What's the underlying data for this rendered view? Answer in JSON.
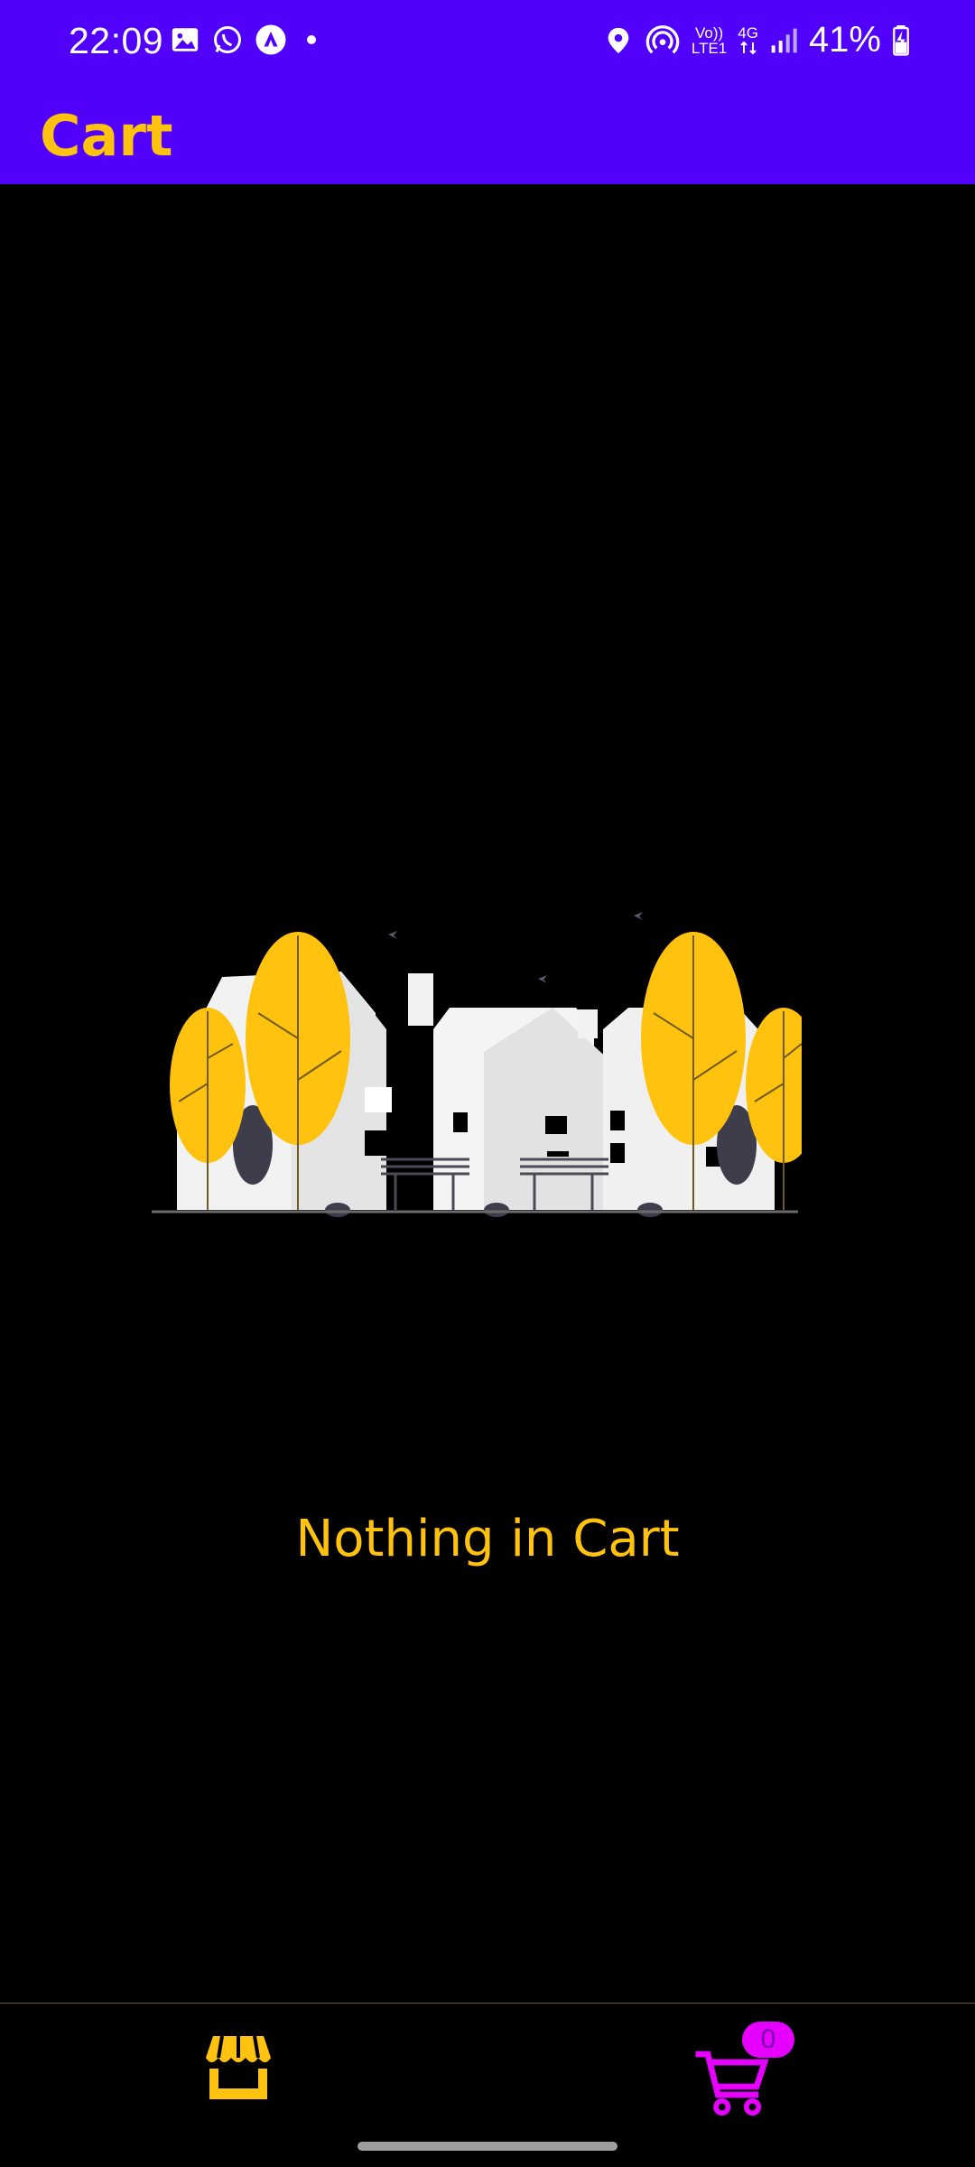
{
  "status_bar": {
    "time": "22:09",
    "network_top": "Vo))",
    "network_bottom": "LTE1",
    "data_type": "4G",
    "battery": "41%"
  },
  "app_bar": {
    "title": "Cart"
  },
  "empty_state": {
    "message": "Nothing in Cart"
  },
  "bottom_nav": {
    "items": [
      {
        "name": "store",
        "icon": "store-icon"
      },
      {
        "name": "cart",
        "icon": "cart-icon",
        "badge": "0"
      }
    ]
  },
  "colors": {
    "primary": "#5100f9",
    "accent": "#ffc20e",
    "badge": "#e600ff",
    "background": "#000000"
  }
}
